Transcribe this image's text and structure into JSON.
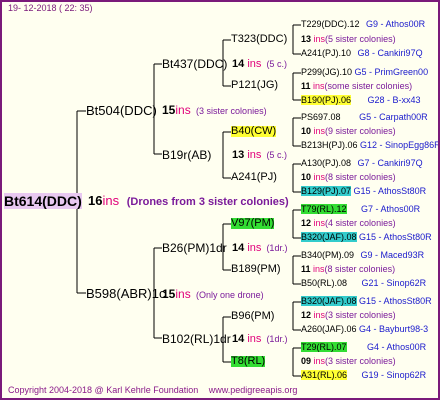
{
  "header": {
    "date": "19-  12-2018  (  22:  35)"
  },
  "footer": {
    "copyright": "Copyright 2004-2018 @ Karl Kehrle Foundation",
    "website": "www.pedigreeapis.org"
  },
  "root": {
    "name": "Bt614(DDC)",
    "count": "16",
    "ins": "ins",
    "note": "(Drones from 3 sister colonies)"
  },
  "gen1": [
    {
      "name": "Bt504(DDC)",
      "count": "15",
      "ins": "ins",
      "note": "(3 sister colonies)"
    },
    {
      "name": "B598(ABR)1c",
      "count": "15",
      "ins": "ins",
      "note": "(Only one drone)"
    }
  ],
  "gen2": [
    {
      "name": "Bt437(DDC)",
      "count": "14",
      "ins": "ins",
      "note": "(5 c.)"
    },
    {
      "name": "B19r(AB)",
      "count": "13",
      "ins": "ins",
      "note": "(5 c.)"
    },
    {
      "name": "B26(PM)1dr",
      "count": "14",
      "ins": "ins",
      "note": "(1dr.)"
    },
    {
      "name": "B102(RL)1dr",
      "count": "14",
      "ins": "ins",
      "note": "(1dr.)"
    }
  ],
  "gen3": [
    {
      "name": "T323(DDC)"
    },
    {
      "name": "P121(JG)"
    },
    {
      "name": "B40(CW)"
    },
    {
      "name": "A241(PJ)"
    },
    {
      "name": "V97(PM)"
    },
    {
      "name": "B189(PM)"
    },
    {
      "name": "B96(PM)"
    },
    {
      "name": "T8(RL)"
    }
  ],
  "gen4": [
    {
      "name": "T229(DDC).12",
      "ref": "G9 - Athos00R"
    },
    {
      "count": "13",
      "ins": "ins",
      "note": "(5 sister colonies)"
    },
    {
      "name": "A241(PJ).10",
      "ref": "G8 - Cankiri97Q"
    },
    {
      "name": "P299(JG).10",
      "ref": "G5 - PrimGreen00"
    },
    {
      "count": "11",
      "ins": "ins",
      "note": "(some sister colonies)"
    },
    {
      "name": "B190(PJ).06",
      "ref": "G28 - B-xx43"
    },
    {
      "name": "PS697.08",
      "ref": "G5 - Carpath00R"
    },
    {
      "count": "10",
      "ins": "ins",
      "note": "(9 sister colonies)"
    },
    {
      "name": "B213H(PJ).06",
      "ref": "G12 - SinopEgg86R"
    },
    {
      "name": "A130(PJ).08",
      "ref": "G7 - Cankiri97Q"
    },
    {
      "count": "10",
      "ins": "ins",
      "note": "(8 sister colonies)"
    },
    {
      "name": "B129(PJ).07",
      "ref": "G15 - AthosSt80R"
    },
    {
      "name": "T79(RL).12",
      "ref": "G7 - Athos00R"
    },
    {
      "count": "12",
      "ins": "ins",
      "note": "(4 sister colonies)"
    },
    {
      "name": "B320(JAF).08",
      "ref": "G15 - AthosSt80R"
    },
    {
      "name": "B340(PM).09",
      "ref": "G9 - Maced93R"
    },
    {
      "count": "11",
      "ins": "ins",
      "note": "(8 sister colonies)"
    },
    {
      "name": "B50(RL).08",
      "ref": "G21 - Sinop62R"
    },
    {
      "name": "B320(JAF).08",
      "ref": "G15 - AthosSt80R"
    },
    {
      "count": "12",
      "ins": "ins",
      "note": "(3 sister colonies)"
    },
    {
      "name": "A260(JAF).06",
      "ref": "G4 - Bayburt98-3"
    },
    {
      "name": "T29(RL).07",
      "ref": "G4 - Athos00R"
    },
    {
      "count": "09",
      "ins": "ins",
      "note": "(3 sister colonies)"
    },
    {
      "name": "A31(RL).06",
      "ref": "G19 - Sinop62R"
    }
  ]
}
